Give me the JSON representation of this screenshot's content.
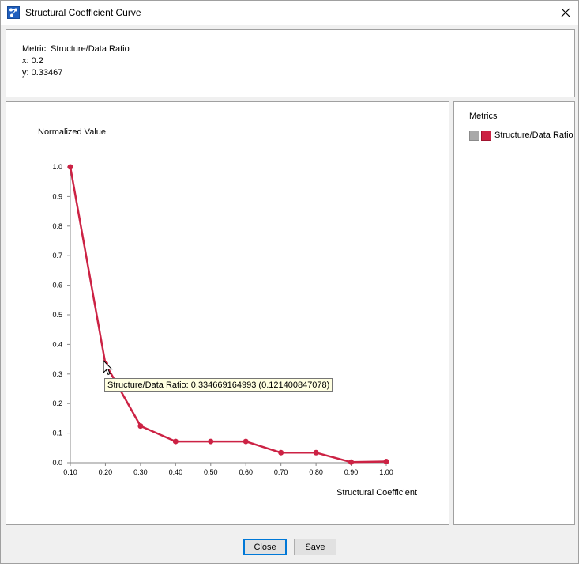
{
  "window": {
    "title": "Structural Coefficient Curve",
    "app_icon": "network-graph-icon",
    "close_icon": "close-icon"
  },
  "info": {
    "metric_line": "Metric: Structure/Data Ratio",
    "x_line": "x: 0.2",
    "y_line": "y: 0.33467"
  },
  "legend": {
    "title": "Metrics",
    "items": [
      {
        "label": "Structure/Data Ratio",
        "color": "#cc2244"
      }
    ]
  },
  "tooltip": {
    "text": "Structure/Data Ratio: 0.334669164993 (0.121400847078)"
  },
  "buttons": {
    "close_label": "Close",
    "save_label": "Save"
  },
  "chart_data": {
    "type": "line",
    "ylabel": "Normalized Value",
    "xlabel": "Structural Coefficient",
    "xlim": [
      0.1,
      1.0
    ],
    "ylim": [
      0.0,
      1.0
    ],
    "x_ticks": [
      "0.10",
      "0.20",
      "0.30",
      "0.40",
      "0.50",
      "0.60",
      "0.70",
      "0.80",
      "0.90",
      "1.00"
    ],
    "y_ticks": [
      "0.0",
      "0.1",
      "0.2",
      "0.3",
      "0.4",
      "0.5",
      "0.6",
      "0.7",
      "0.8",
      "0.9",
      "1.0"
    ],
    "grid": false,
    "series": [
      {
        "name": "Structure/Data Ratio",
        "color": "#cc2244",
        "x": [
          0.1,
          0.2,
          0.3,
          0.4,
          0.5,
          0.6,
          0.7,
          0.8,
          0.9,
          1.0
        ],
        "y": [
          1.0,
          0.33467,
          0.124,
          0.072,
          0.072,
          0.072,
          0.034,
          0.034,
          0.002,
          0.004
        ]
      }
    ]
  }
}
